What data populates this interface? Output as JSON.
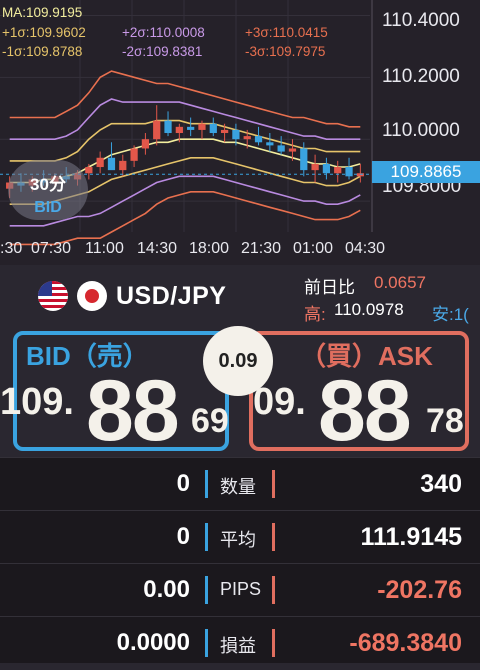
{
  "chart": {
    "legend": {
      "ma": "MA:109.9195",
      "p1": "+1σ:109.9602",
      "p2": "+2σ:110.0008",
      "p3": "+3σ:110.0415",
      "m1": "-1σ:109.8788",
      "m2": "-2σ:109.8381",
      "m3": "-3σ:109.7975"
    },
    "price_axis": [
      "110.4000",
      "110.2000",
      "110.0000",
      "109.8000"
    ],
    "current_price": "109.8865",
    "time_axis": [
      ":30",
      "07:30",
      "11:00",
      "14:30",
      "18:00",
      "21:30",
      "01:00",
      "04:30"
    ],
    "timeframe": "30分",
    "side": "BID",
    "colors": {
      "ma": "#f3ee9e",
      "s1": "#e6c46a",
      "s2": "#b98ae0",
      "s3": "#e8704f",
      "up": "#e2574a",
      "down": "#3aa3e0"
    }
  },
  "chart_data": {
    "type": "candlestick",
    "ylim": [
      109.7,
      110.45
    ],
    "ylabels": [
      "110.4000",
      "110.2000",
      "110.0000",
      "109.8000"
    ],
    "xlabels": [
      ":30",
      "07:30",
      "11:00",
      "14:30",
      "18:00",
      "21:30",
      "01:00",
      "04:30"
    ],
    "bands": {
      "ma": [
        109.86,
        109.86,
        109.86,
        109.87,
        109.87,
        109.88,
        109.89,
        109.91,
        109.93,
        109.95,
        109.96,
        109.97,
        109.98,
        109.99,
        109.99,
        110.0,
        110.0,
        110.0,
        110.0,
        109.99,
        109.99,
        109.98,
        109.97,
        109.96,
        109.95,
        109.94,
        109.93,
        109.92,
        109.92,
        109.91,
        109.91,
        109.92
      ],
      "p1": [
        109.93,
        109.93,
        109.93,
        109.93,
        109.93,
        109.94,
        109.96,
        110.0,
        110.03,
        110.05,
        110.05,
        110.05,
        110.05,
        110.06,
        110.06,
        110.06,
        110.05,
        110.05,
        110.05,
        110.04,
        110.03,
        110.02,
        110.01,
        110.0,
        109.99,
        109.98,
        109.97,
        109.97,
        109.96,
        109.96,
        109.96,
        109.96
      ],
      "p2": [
        110.0,
        110.0,
        110.0,
        110.0,
        110.0,
        110.01,
        110.03,
        110.07,
        110.11,
        110.13,
        110.12,
        110.12,
        110.12,
        110.12,
        110.12,
        110.12,
        110.11,
        110.1,
        110.09,
        110.08,
        110.07,
        110.06,
        110.05,
        110.04,
        110.03,
        110.02,
        110.01,
        110.01,
        110.0,
        110.0,
        110.0,
        110.0
      ],
      "p3": [
        110.07,
        110.07,
        110.07,
        110.07,
        110.07,
        110.09,
        110.11,
        110.15,
        110.2,
        110.22,
        110.21,
        110.2,
        110.19,
        110.18,
        110.18,
        110.17,
        110.16,
        110.15,
        110.14,
        110.13,
        110.12,
        110.11,
        110.1,
        110.09,
        110.08,
        110.07,
        110.07,
        110.06,
        110.05,
        110.05,
        110.04,
        110.04
      ],
      "m1": [
        109.79,
        109.79,
        109.79,
        109.79,
        109.8,
        109.81,
        109.82,
        109.83,
        109.85,
        109.87,
        109.88,
        109.89,
        109.9,
        109.91,
        109.92,
        109.93,
        109.94,
        109.94,
        109.94,
        109.93,
        109.92,
        109.91,
        109.9,
        109.89,
        109.88,
        109.87,
        109.86,
        109.86,
        109.85,
        109.85,
        109.86,
        109.88
      ],
      "m2": [
        109.72,
        109.72,
        109.72,
        109.72,
        109.73,
        109.74,
        109.75,
        109.75,
        109.76,
        109.78,
        109.8,
        109.82,
        109.84,
        109.86,
        109.87,
        109.88,
        109.88,
        109.88,
        109.88,
        109.87,
        109.86,
        109.85,
        109.84,
        109.83,
        109.82,
        109.81,
        109.8,
        109.8,
        109.79,
        109.79,
        109.8,
        109.82
      ],
      "m3": [
        109.66,
        109.66,
        109.66,
        109.66,
        109.66,
        109.67,
        109.68,
        109.68,
        109.68,
        109.7,
        109.72,
        109.74,
        109.76,
        109.79,
        109.81,
        109.82,
        109.83,
        109.83,
        109.83,
        109.82,
        109.81,
        109.8,
        109.79,
        109.78,
        109.77,
        109.76,
        109.75,
        109.74,
        109.74,
        109.74,
        109.75,
        109.77
      ]
    },
    "candles": [
      {
        "o": 109.84,
        "h": 109.88,
        "l": 109.81,
        "c": 109.86
      },
      {
        "o": 109.86,
        "h": 109.89,
        "l": 109.83,
        "c": 109.85
      },
      {
        "o": 109.85,
        "h": 109.88,
        "l": 109.83,
        "c": 109.87
      },
      {
        "o": 109.87,
        "h": 109.9,
        "l": 109.85,
        "c": 109.86
      },
      {
        "o": 109.86,
        "h": 109.89,
        "l": 109.84,
        "c": 109.88
      },
      {
        "o": 109.88,
        "h": 109.91,
        "l": 109.86,
        "c": 109.87
      },
      {
        "o": 109.87,
        "h": 109.9,
        "l": 109.85,
        "c": 109.89
      },
      {
        "o": 109.89,
        "h": 109.92,
        "l": 109.87,
        "c": 109.91
      },
      {
        "o": 109.91,
        "h": 109.96,
        "l": 109.89,
        "c": 109.94
      },
      {
        "o": 109.94,
        "h": 109.99,
        "l": 109.92,
        "c": 109.9
      },
      {
        "o": 109.9,
        "h": 109.95,
        "l": 109.88,
        "c": 109.93
      },
      {
        "o": 109.93,
        "h": 109.98,
        "l": 109.91,
        "c": 109.97
      },
      {
        "o": 109.97,
        "h": 110.02,
        "l": 109.95,
        "c": 110.0
      },
      {
        "o": 110.0,
        "h": 110.11,
        "l": 109.98,
        "c": 110.06
      },
      {
        "o": 110.06,
        "h": 110.09,
        "l": 110.01,
        "c": 110.02
      },
      {
        "o": 110.02,
        "h": 110.05,
        "l": 109.99,
        "c": 110.04
      },
      {
        "o": 110.04,
        "h": 110.07,
        "l": 110.01,
        "c": 110.03
      },
      {
        "o": 110.03,
        "h": 110.06,
        "l": 110.0,
        "c": 110.05
      },
      {
        "o": 110.05,
        "h": 110.07,
        "l": 110.01,
        "c": 110.02
      },
      {
        "o": 110.02,
        "h": 110.05,
        "l": 109.99,
        "c": 110.03
      },
      {
        "o": 110.03,
        "h": 110.05,
        "l": 109.98,
        "c": 110.0
      },
      {
        "o": 110.0,
        "h": 110.03,
        "l": 109.97,
        "c": 110.01
      },
      {
        "o": 110.01,
        "h": 110.04,
        "l": 109.98,
        "c": 109.99
      },
      {
        "o": 109.99,
        "h": 110.02,
        "l": 109.96,
        "c": 109.98
      },
      {
        "o": 109.98,
        "h": 110.01,
        "l": 109.95,
        "c": 109.96
      },
      {
        "o": 109.96,
        "h": 110.0,
        "l": 109.93,
        "c": 109.97
      },
      {
        "o": 109.97,
        "h": 109.99,
        "l": 109.88,
        "c": 109.9
      },
      {
        "o": 109.9,
        "h": 109.95,
        "l": 109.86,
        "c": 109.92
      },
      {
        "o": 109.92,
        "h": 109.94,
        "l": 109.87,
        "c": 109.89
      },
      {
        "o": 109.89,
        "h": 109.93,
        "l": 109.86,
        "c": 109.91
      },
      {
        "o": 109.91,
        "h": 109.94,
        "l": 109.87,
        "c": 109.88
      },
      {
        "o": 109.88,
        "h": 109.92,
        "l": 109.86,
        "c": 109.89
      }
    ]
  },
  "pair": {
    "name": "USD/JPY",
    "change_label": "前日比",
    "change_value": "0.0657",
    "high_label": "高:",
    "high_value": "110.0978",
    "low_label": "安:1("
  },
  "bid": {
    "label": "BID（売）",
    "prefix": "109.",
    "big": "88",
    "small": "69"
  },
  "ask": {
    "label": "（買）ASK",
    "prefix": "09.",
    "big": "88",
    "small": "78"
  },
  "spread": "0.09",
  "table": [
    {
      "left": "0",
      "label": "数量",
      "right": "340",
      "right_color": "#ffffff"
    },
    {
      "left": "0",
      "label": "平均",
      "right": "111.9145",
      "right_color": "#ffffff"
    },
    {
      "left": "0.00",
      "label": "PIPS",
      "right": "-202.76",
      "right_color": "#ef7563"
    },
    {
      "left": "0.0000",
      "label": "損益",
      "right": "-689.3840",
      "right_color": "#ef7563"
    }
  ]
}
